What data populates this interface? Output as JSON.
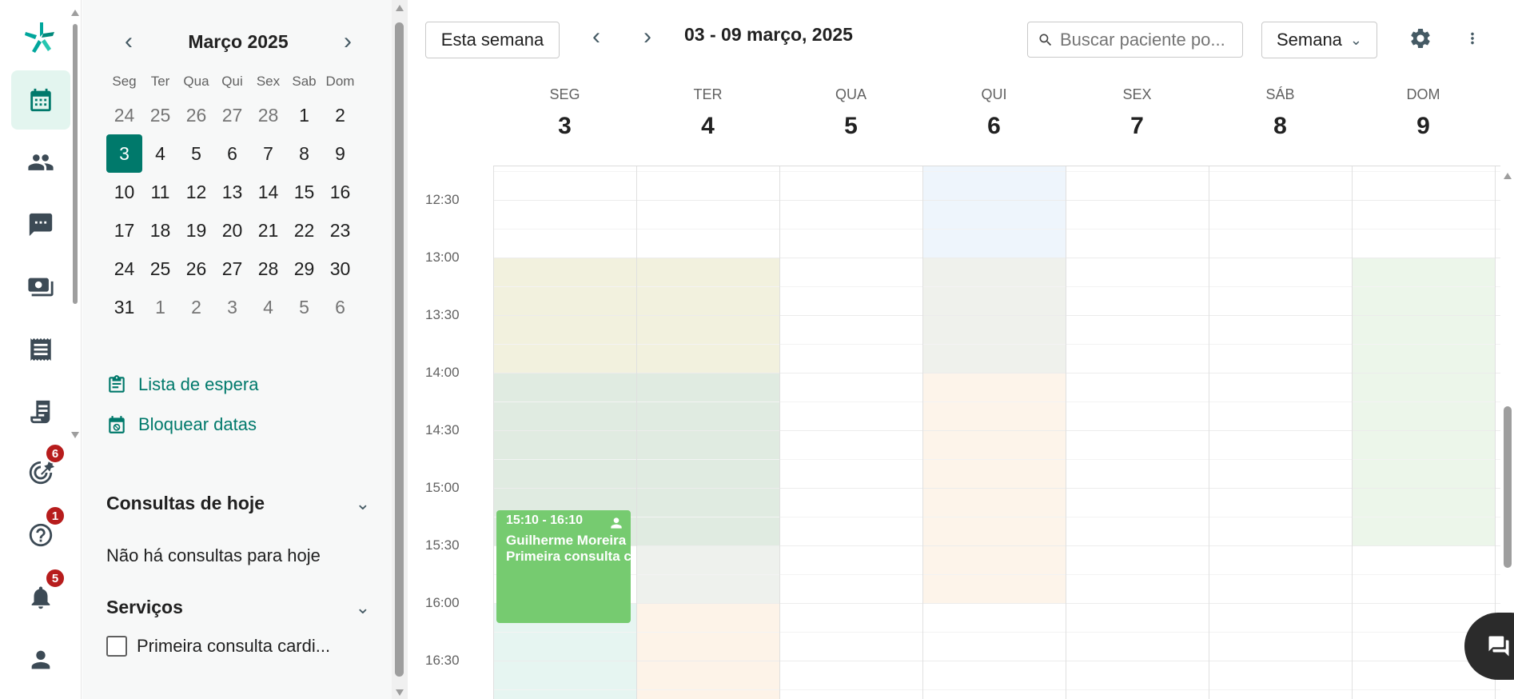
{
  "rail": {
    "badges": {
      "goals": "6",
      "help": "1",
      "notifications": "5"
    }
  },
  "mini_calendar": {
    "month_title": "Março 2025",
    "weekdays": [
      "Seg",
      "Ter",
      "Qua",
      "Qui",
      "Sex",
      "Sab",
      "Dom"
    ],
    "weeks": [
      [
        "24",
        "25",
        "26",
        "27",
        "28",
        "1",
        "2"
      ],
      [
        "3",
        "4",
        "5",
        "6",
        "7",
        "8",
        "9"
      ],
      [
        "10",
        "11",
        "12",
        "13",
        "14",
        "15",
        "16"
      ],
      [
        "17",
        "18",
        "19",
        "20",
        "21",
        "22",
        "23"
      ],
      [
        "24",
        "25",
        "26",
        "27",
        "28",
        "29",
        "30"
      ],
      [
        "31",
        "1",
        "2",
        "3",
        "4",
        "5",
        "6"
      ]
    ],
    "selected_day": "3"
  },
  "side": {
    "waitlist_label": "Lista de espera",
    "block_dates_label": "Bloquear datas",
    "today_title": "Consultas de hoje",
    "today_empty": "Não há consultas para hoje",
    "services_title": "Serviços",
    "service_item": "Primeira consulta cardi..."
  },
  "toolbar": {
    "this_week": "Esta semana",
    "range": "03 - 09 março, 2025",
    "search_placeholder": "Buscar paciente po...",
    "view": "Semana"
  },
  "days": [
    {
      "name": "SEG",
      "date": "3"
    },
    {
      "name": "TER",
      "date": "4"
    },
    {
      "name": "QUA",
      "date": "5"
    },
    {
      "name": "QUI",
      "date": "6"
    },
    {
      "name": "SEX",
      "date": "7"
    },
    {
      "name": "SÁB",
      "date": "8"
    },
    {
      "name": "DOM",
      "date": "9"
    }
  ],
  "times": [
    "12:30",
    "13:00",
    "13:30",
    "14:00",
    "14:30",
    "15:00",
    "15:30",
    "16:00",
    "16:30"
  ],
  "event": {
    "time": "15:10 - 16:10",
    "patient": "Guilherme Moreira",
    "service": "Primeira consulta cardiológica"
  },
  "colors": {
    "primary": "#00796b",
    "event": "#76cb70",
    "badge": "#b71c1c"
  }
}
